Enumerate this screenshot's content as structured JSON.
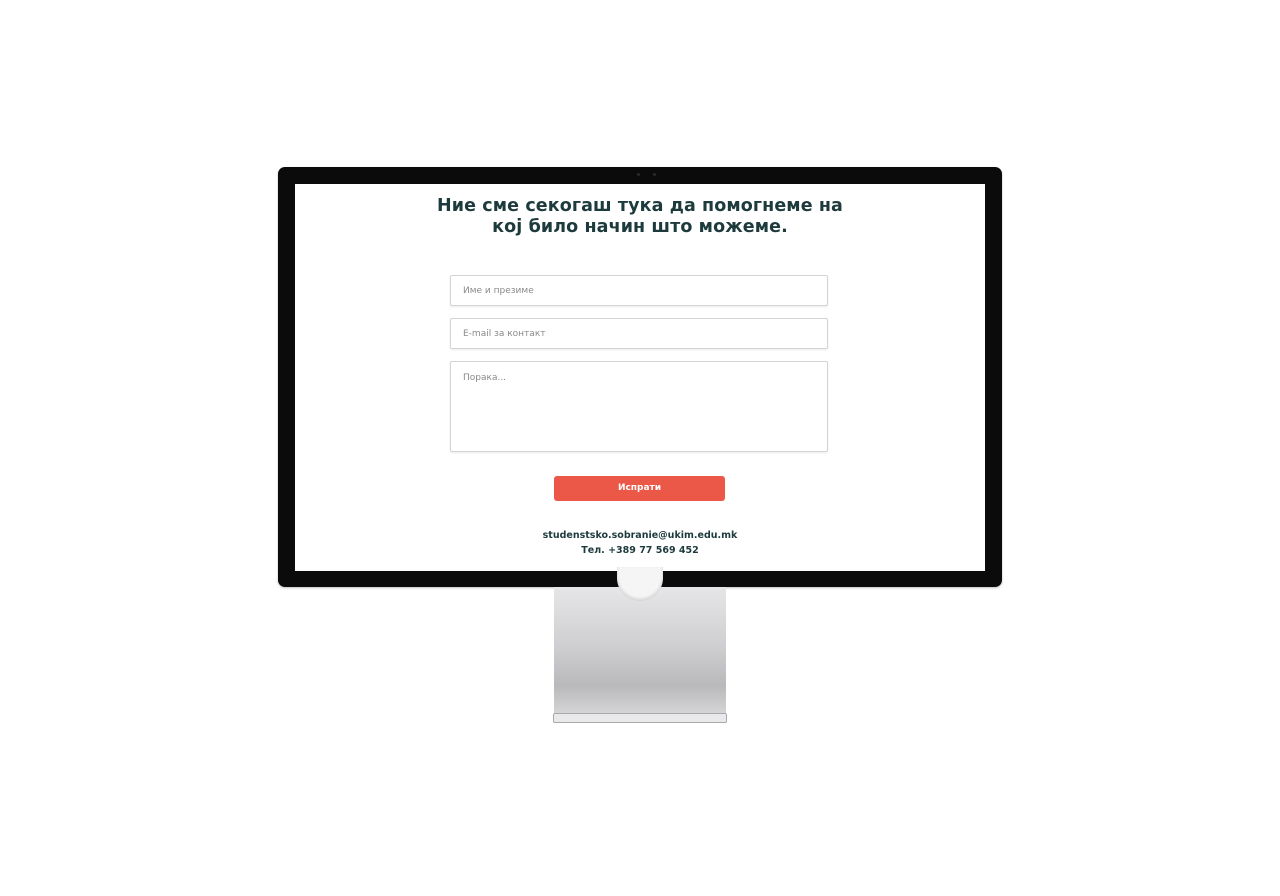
{
  "page": {
    "headline_line1": "Ние сме секогаш тука да помогнеме на",
    "headline_line2": "кој било начин што можеме."
  },
  "form": {
    "name_placeholder": "Име и презиме",
    "email_placeholder": "E-mail за контакт",
    "message_placeholder": "Порака...",
    "submit_label": "Испрати"
  },
  "contact": {
    "email": "studenstsko.sobranie@ukim.edu.mk",
    "phone": "Тел. +389 77 569 452"
  },
  "colors": {
    "heading": "#1d3a3c",
    "accent": "#ec5848"
  }
}
